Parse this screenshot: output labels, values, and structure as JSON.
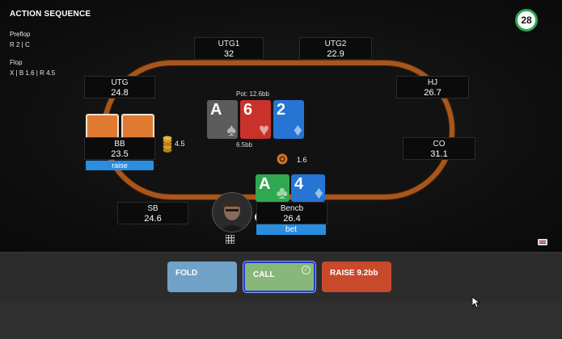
{
  "action_sequence": {
    "title": "ACTION SEQUENCE",
    "preflop_label": "Preflop",
    "preflop_actions": "R 2  |  C",
    "flop_label": "Flop",
    "flop_actions": "X  |  B 1.6  |  R 4.5"
  },
  "timer": {
    "value": "28",
    "color": "#2fa84f"
  },
  "pot": {
    "label": "Pot: 12.6bb",
    "bet_label": "6.5bb"
  },
  "board": [
    {
      "rank": "A",
      "suit": "♠",
      "color": "#5c5c5c"
    },
    {
      "rank": "6",
      "suit": "♥",
      "color": "#c8322a"
    },
    {
      "rank": "2",
      "suit": "♦",
      "color": "#2674d4"
    }
  ],
  "hero_cards": [
    {
      "rank": "A",
      "suit": "♣",
      "color": "#2fa84f"
    },
    {
      "rank": "4",
      "suit": "♦",
      "color": "#2674d4"
    }
  ],
  "seats": {
    "utg1": {
      "name": "UTG1",
      "stack": "32"
    },
    "utg2": {
      "name": "UTG2",
      "stack": "22.9"
    },
    "utg": {
      "name": "UTG",
      "stack": "24.8"
    },
    "hj": {
      "name": "HJ",
      "stack": "26.7"
    },
    "bb": {
      "name": "BB",
      "stack": "23.5",
      "action": "raise",
      "bet": "4.5"
    },
    "co": {
      "name": "CO",
      "stack": "31.1"
    },
    "sb": {
      "name": "SB",
      "stack": "24.6"
    },
    "hero": {
      "name": "Bencb",
      "stack": "26.4",
      "action": "bet",
      "bet": "1.6"
    }
  },
  "actions": {
    "fold": "FOLD",
    "call": "CALL",
    "raise": "RAISE 9.2bb"
  },
  "colors": {
    "fold": "#6fa2c6",
    "call": "#88b77a",
    "raise": "#c94a2a",
    "rail": "#a8561c",
    "action_tag": "#2a8de0"
  }
}
